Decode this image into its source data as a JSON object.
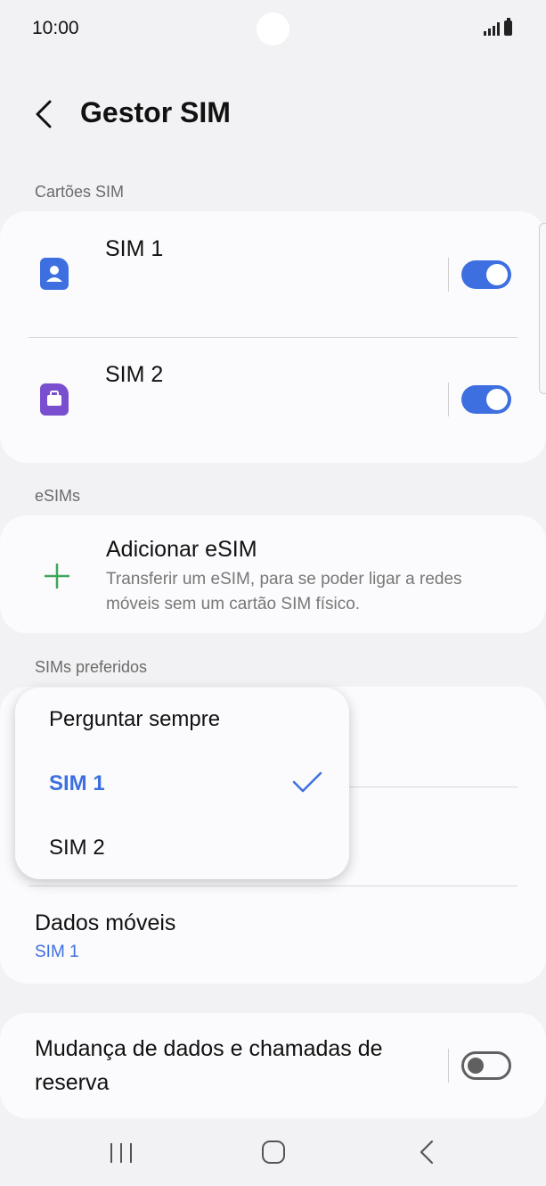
{
  "status_bar": {
    "time": "10:00"
  },
  "header": {
    "title": "Gestor SIM"
  },
  "sections": {
    "sim_cards_label": "Cartões SIM",
    "esims_label": "eSIMs",
    "preferred_label": "SIMs preferidos"
  },
  "sim_cards": [
    {
      "name": "SIM 1",
      "icon": "person-sim-icon",
      "color": "#3d6fe0",
      "enabled": true
    },
    {
      "name": "SIM 2",
      "icon": "briefcase-sim-icon",
      "color": "#7a4fcf",
      "enabled": true
    }
  ],
  "esim": {
    "title": "Adicionar eSIM",
    "description_line1": "Transferir um eSIM, para se poder ligar a redes",
    "description_line2": "móveis sem um cartão SIM físico."
  },
  "dropdown": {
    "options": [
      "Perguntar sempre",
      "SIM 1",
      "SIM 2"
    ],
    "selected_index": 1
  },
  "mobile_data": {
    "title": "Dados móveis",
    "value": "SIM 1"
  },
  "backup": {
    "title_line1": "Mudança de dados e chamadas de",
    "title_line2": "reserva",
    "enabled": false
  },
  "colors": {
    "accent": "#3d6fe0",
    "esim_plus": "#3fa75a",
    "background": "#f2f2f4"
  }
}
